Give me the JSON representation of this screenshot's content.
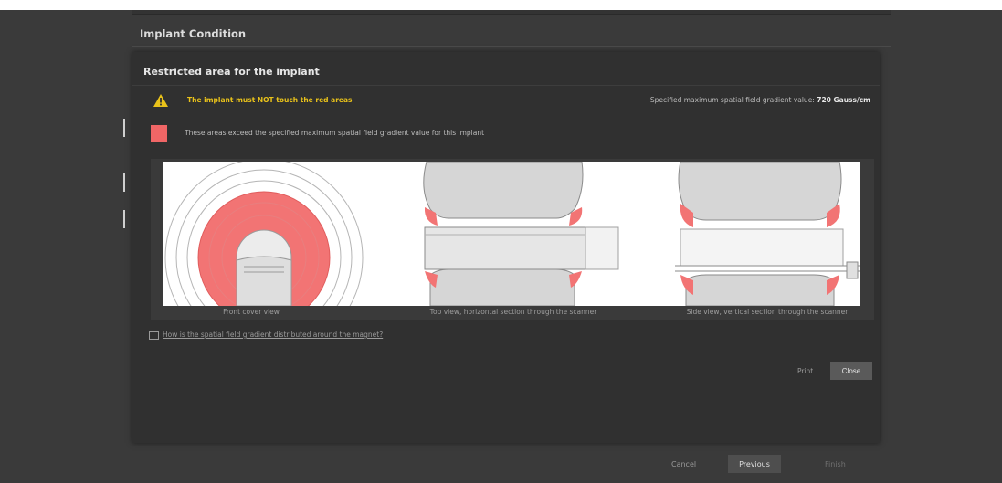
{
  "window": {
    "title": "Implant Condition"
  },
  "dialog": {
    "title": "Restricted area for the implant",
    "warning_text": "The implant must NOT touch the red areas",
    "gradient_label": "Specified maximum spatial field gradient value:",
    "gradient_value": "720 Gauss/cm",
    "legend_text": "These areas exceed the specified maximum spatial field gradient value for this implant",
    "views": [
      {
        "caption": "Front cover view"
      },
      {
        "caption": "Top view, horizontal section through the scanner"
      },
      {
        "caption": "Side view, vertical section through the scanner"
      }
    ],
    "info_link": "How is the spatial field gradient distributed around the magnet?",
    "print_label": "Print",
    "close_label": "Close"
  },
  "footer": {
    "cancel_label": "Cancel",
    "previous_label": "Previous",
    "finish_label": "Finish"
  },
  "colors": {
    "background": "#3a3a3a",
    "dialog": "#303030",
    "warning": "#e9c21a",
    "restricted": "#f06666",
    "diagram_bg": "#ffffff"
  },
  "icons": {
    "warning": "warning-triangle-icon",
    "restricted_swatch": "red-square",
    "info": "monitor-icon"
  }
}
